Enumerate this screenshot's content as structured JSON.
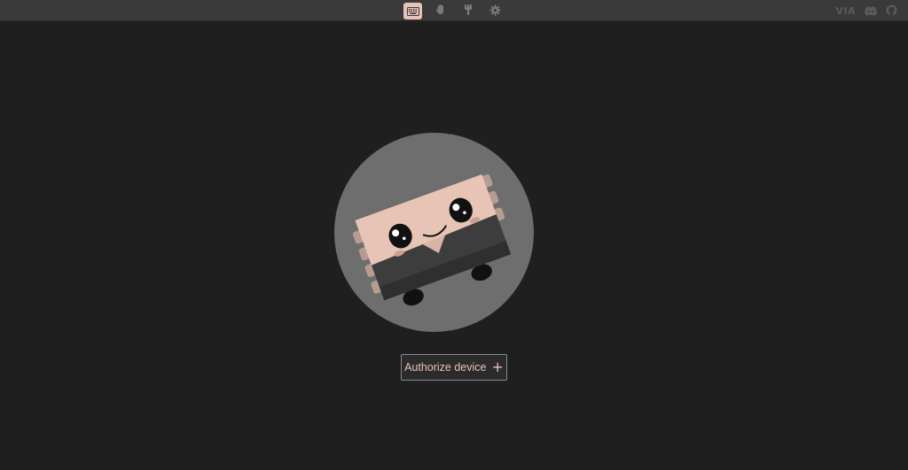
{
  "topbar": {
    "nav": [
      {
        "name": "configure",
        "icon": "keyboard-icon",
        "active": true
      },
      {
        "name": "key-tester",
        "icon": "hand-pointer-icon",
        "active": false
      },
      {
        "name": "design",
        "icon": "brush-icon",
        "active": false
      },
      {
        "name": "settings",
        "icon": "gear-icon",
        "active": false
      }
    ],
    "logo_text": "VIA",
    "right_icons": [
      "discord-icon",
      "github-icon"
    ]
  },
  "main": {
    "mascot": "keyboard-mascot-illustration",
    "authorize_label": "Authorize device",
    "authorize_icon": "plus-icon",
    "authorize_glyph": "+"
  },
  "colors": {
    "accent": "#e8c4b6",
    "background": "#1f1f1f",
    "topbar": "#3a3a3a",
    "circle": "#6e6e6e"
  }
}
